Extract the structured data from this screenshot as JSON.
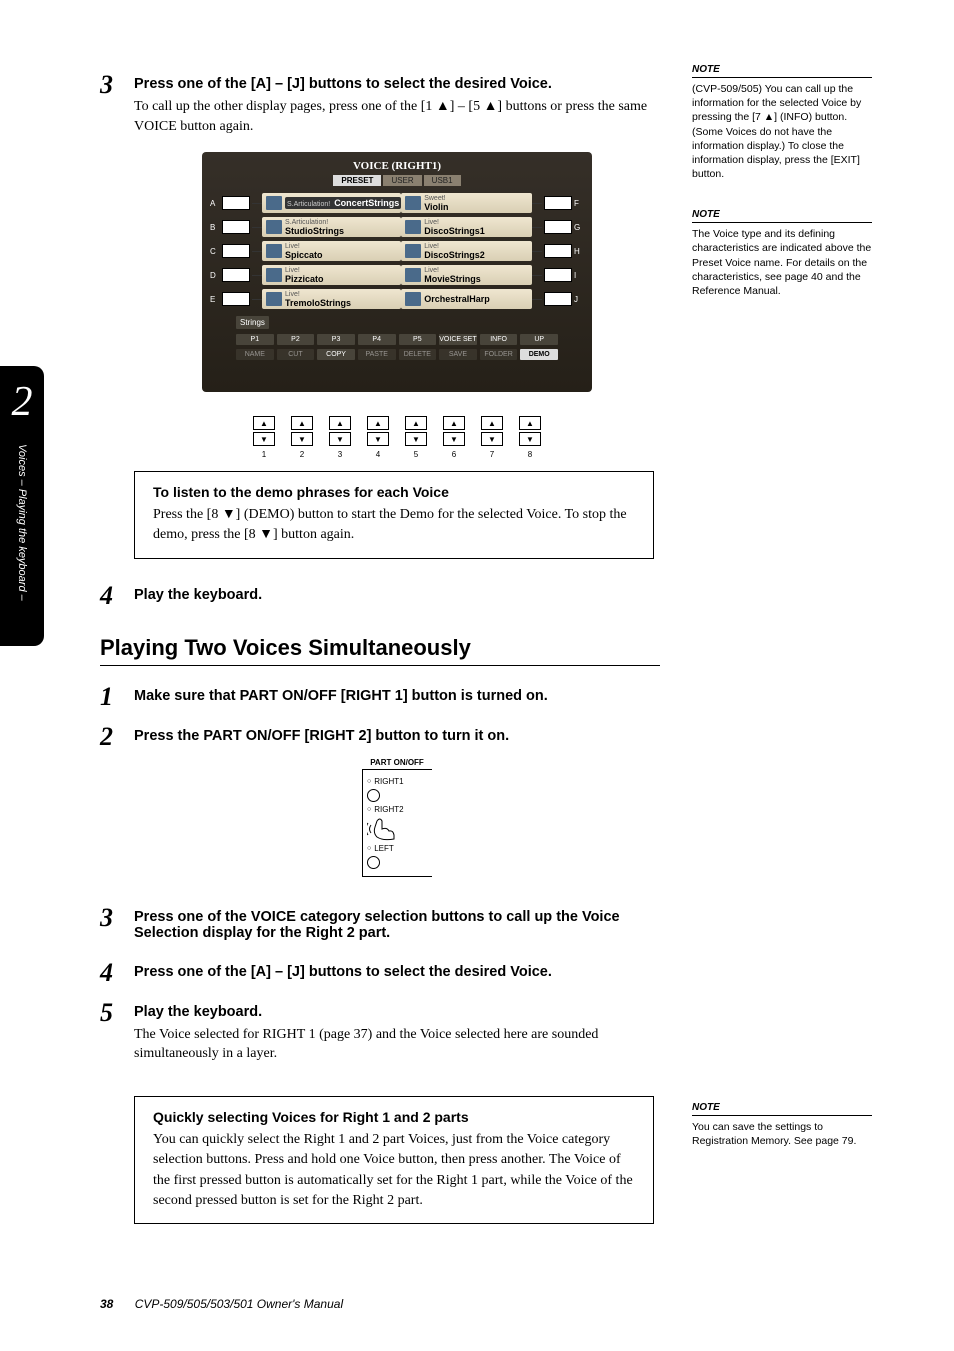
{
  "tab": {
    "number": "2",
    "label": "Voices – Playing the keyboard –"
  },
  "steps_top": {
    "s3": {
      "num": "3",
      "title": "Press one of the [A] – [J] buttons to select the desired Voice.",
      "para": "To call up the other display pages, press one of the [1 ▲] – [5 ▲] buttons or press the same VOICE button again."
    },
    "s4": {
      "num": "4",
      "title": "Play the keyboard."
    }
  },
  "voice_screen": {
    "title": "VOICE (RIGHT1)",
    "tabs": [
      "PRESET",
      "USER",
      "USB1"
    ],
    "left": [
      {
        "k": "A",
        "sub": "S.Articulation!",
        "name": "ConcertStrings",
        "selected": true
      },
      {
        "k": "B",
        "sub": "S.Articulation!",
        "name": "StudioStrings"
      },
      {
        "k": "C",
        "sub": "Live!",
        "name": "Spiccato"
      },
      {
        "k": "D",
        "sub": "Live!",
        "name": "Pizzicato"
      },
      {
        "k": "E",
        "sub": "Live!",
        "name": "TremoloStrings"
      }
    ],
    "right": [
      {
        "k": "F",
        "sub": "Sweet!",
        "name": "Violin"
      },
      {
        "k": "G",
        "sub": "Live!",
        "name": "DiscoStrings1"
      },
      {
        "k": "H",
        "sub": "Live!",
        "name": "DiscoStrings2"
      },
      {
        "k": "I",
        "sub": "Live!",
        "name": "MovieStrings"
      },
      {
        "k": "J",
        "sub": "",
        "name": "OrchestralHarp"
      }
    ],
    "strings": "Strings",
    "cells": [
      "P1",
      "P2",
      "P3",
      "P4",
      "P5",
      "VOICE SET",
      "INFO",
      "UP"
    ],
    "cells2": [
      "NAME",
      "CUT",
      "COPY",
      "PASTE",
      "DELETE",
      "SAVE",
      "FOLDER",
      "DEMO"
    ],
    "buttons": [
      "1",
      "2",
      "3",
      "4",
      "5",
      "6",
      "7",
      "8"
    ]
  },
  "demo_box": {
    "title": "To listen to the demo phrases for each Voice",
    "text": "Press the [8 ▼] (DEMO) button to start the Demo for the selected Voice. To stop the demo, press the [8 ▼] button again."
  },
  "section_title": "Playing Two Voices Simultaneously",
  "steps_bottom": {
    "s1": {
      "num": "1",
      "title": "Make sure that PART ON/OFF [RIGHT 1] button is turned on."
    },
    "s2": {
      "num": "2",
      "title": "Press the PART ON/OFF [RIGHT 2] button to turn it on."
    },
    "s3": {
      "num": "3",
      "title": "Press one of the VOICE category selection buttons to call up the Voice Selection display for the Right 2 part."
    },
    "s4": {
      "num": "4",
      "title": "Press one of the [A] – [J] buttons to select the desired Voice."
    },
    "s5": {
      "num": "5",
      "title": "Play the keyboard.",
      "para": "The Voice selected for RIGHT 1 (page 37) and the Voice selected here are sounded simultaneously in a layer."
    }
  },
  "partonoff": {
    "title": "PART ON/OFF",
    "r1": "RIGHT1",
    "r2": "RIGHT2",
    "left": "LEFT"
  },
  "quick_box": {
    "title": "Quickly selecting Voices for Right 1 and 2 parts",
    "text": "You can quickly select the Right 1 and 2 part Voices, just from the Voice category selection buttons. Press and hold one Voice button, then press another. The Voice of the first pressed button is automatically set for the Right 1 part, while the Voice of the second pressed button is set for the Right 2 part."
  },
  "notes": {
    "n1": {
      "hdr": "NOTE",
      "text": "(CVP-509/505) You can call up the information for the selected Voice by pressing the [7 ▲] (INFO) button. (Some Voices do not have the information display.) To close the information display, press the [EXIT] button."
    },
    "n2": {
      "hdr": "NOTE",
      "text": "The Voice type and its defining characteristics are indicated above the Preset Voice name. For details on the characteristics, see page 40 and the Reference Manual."
    },
    "n3": {
      "hdr": "NOTE",
      "text": "You can save the settings to Registration Memory. See page 79."
    }
  },
  "footer": {
    "page": "38",
    "title": "CVP-509/505/503/501 Owner's Manual"
  }
}
